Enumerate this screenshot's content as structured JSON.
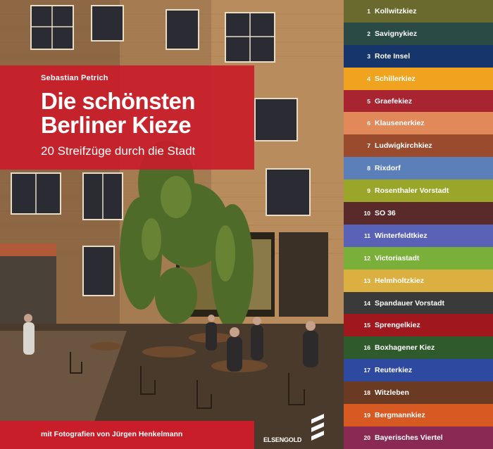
{
  "book": {
    "author": "Sebastian Petrich",
    "title_line1": "Die schönsten",
    "title_line2": "Berliner Kieze",
    "subtitle": "20 Streifzüge durch die Stadt",
    "photographer": "mit Fotografien von Jürgen Henkelmann",
    "publisher": "ELSENGOLD"
  },
  "colors": {
    "title_box": "#c81e2a",
    "bottom_bar": "#c81e2a"
  },
  "kieze": [
    {
      "num": "1",
      "name": "Kollwitzkiez",
      "color": "#6b6a2e"
    },
    {
      "num": "2",
      "name": "Savignykiez",
      "color": "#2a4a45"
    },
    {
      "num": "3",
      "name": "Rote Insel",
      "color": "#16356a"
    },
    {
      "num": "4",
      "name": "Schillerkiez",
      "color": "#f0a31e"
    },
    {
      "num": "5",
      "name": "Graefekiez",
      "color": "#a72430"
    },
    {
      "num": "6",
      "name": "Klausenerkiez",
      "color": "#e2895a"
    },
    {
      "num": "7",
      "name": "Ludwigkirchkiez",
      "color": "#9a4b2e"
    },
    {
      "num": "8",
      "name": "Rixdorf",
      "color": "#5b7fb8"
    },
    {
      "num": "9",
      "name": "Rosenthaler Vorstadt",
      "color": "#9aa62a"
    },
    {
      "num": "10",
      "name": "SO 36",
      "color": "#5a2a2a"
    },
    {
      "num": "11",
      "name": "Winterfeldtkiez",
      "color": "#5a62b8"
    },
    {
      "num": "12",
      "name": "Victoriastadt",
      "color": "#7ab03a"
    },
    {
      "num": "13",
      "name": "Helmholtzkiez",
      "color": "#dcb040"
    },
    {
      "num": "14",
      "name": "Spandauer Vorstadt",
      "color": "#3a3a3a"
    },
    {
      "num": "15",
      "name": "Sprengelkiez",
      "color": "#a0181e"
    },
    {
      "num": "16",
      "name": "Boxhagener Kiez",
      "color": "#2e5a2c"
    },
    {
      "num": "17",
      "name": "Reuterkiez",
      "color": "#2e4aa0"
    },
    {
      "num": "18",
      "name": "Witzleben",
      "color": "#6a3a22"
    },
    {
      "num": "19",
      "name": "Bergmannkiez",
      "color": "#d65a22"
    },
    {
      "num": "20",
      "name": "Bayerisches Viertel",
      "color": "#8a2a52"
    }
  ]
}
